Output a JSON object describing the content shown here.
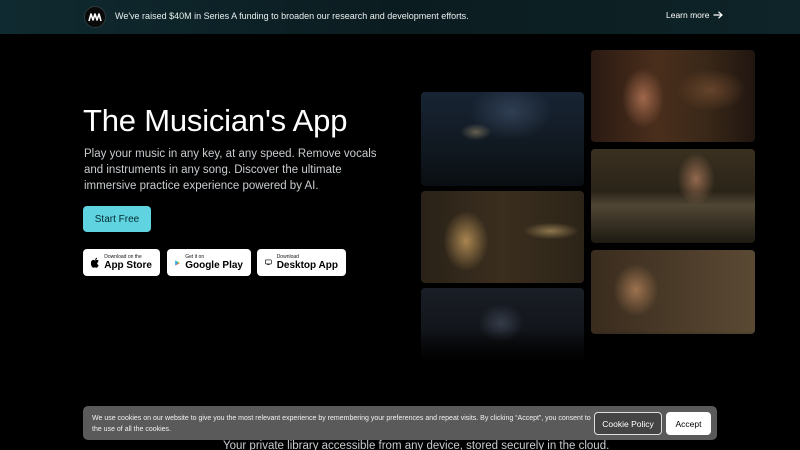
{
  "announcement": {
    "text": "We've raised $40M in Series A funding to broaden our research and development efforts.",
    "link_label": "Learn more"
  },
  "hero": {
    "title": "The Musician's App",
    "subtitle": "Play your music in any key, at any speed. Remove vocals and instruments in any song. Discover the ultimate immersive practice experience powered by AI.",
    "cta_label": "Start Free"
  },
  "downloads": [
    {
      "small": "Download on the",
      "large": "App Store",
      "icon": "apple-icon"
    },
    {
      "small": "Get it on",
      "large": "Google Play",
      "icon": "google-play-icon"
    },
    {
      "small": "Download",
      "large": "Desktop App",
      "icon": "desktop-icon"
    }
  ],
  "bottom_text": "Your private library accessible from any device, stored securely in the cloud.",
  "cookie": {
    "text": "We use cookies on our website to give you the most relevant experience by remembering your preferences and repeat visits. By clicking “Accept”, you consent to the use of all the cookies.",
    "policy_label": "Cookie Policy",
    "accept_label": "Accept"
  },
  "colors": {
    "accent": "#5fd4e0",
    "background": "#000000",
    "cookie_bg": "#5a5a5a"
  }
}
